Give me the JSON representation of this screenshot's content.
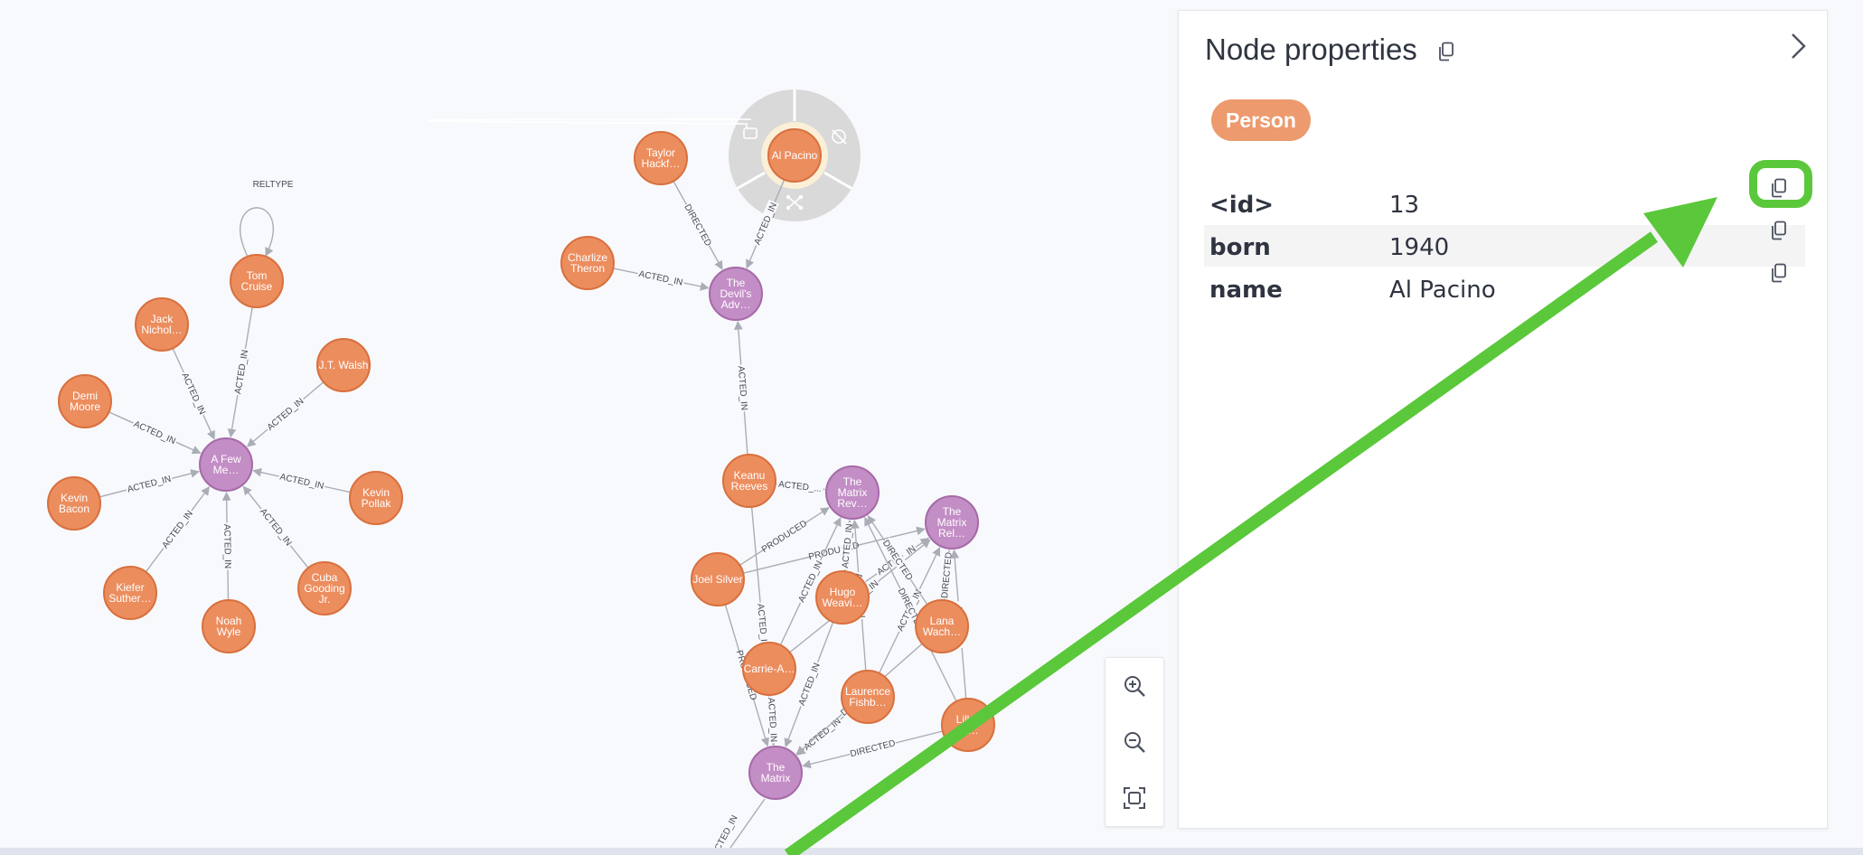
{
  "graph": {
    "colors": {
      "person_fill": "#ec8d5e",
      "person_stroke": "#d8703e",
      "movie_fill": "#c38dc5",
      "movie_stroke": "#a56aa8",
      "edge": "#a9adb5"
    },
    "nodes": [
      {
        "id": "tomcruise",
        "lines": [
          "Tom",
          "Cruise"
        ],
        "kind": "person"
      },
      {
        "id": "jacknic",
        "lines": [
          "Jack",
          "Nichol…"
        ],
        "kind": "person"
      },
      {
        "id": "jtwalsh",
        "lines": [
          "J.T. Walsh"
        ],
        "kind": "person"
      },
      {
        "id": "demimoore",
        "lines": [
          "Demi",
          "Moore"
        ],
        "kind": "person"
      },
      {
        "id": "afewmen",
        "lines": [
          "A Few",
          "Me…"
        ],
        "kind": "movie"
      },
      {
        "id": "kevinbacon",
        "lines": [
          "Kevin",
          "Bacon"
        ],
        "kind": "person"
      },
      {
        "id": "kevinpollak",
        "lines": [
          "Kevin",
          "Pollak"
        ],
        "kind": "person"
      },
      {
        "id": "kiefer",
        "lines": [
          "Kiefer",
          "Suther…"
        ],
        "kind": "person"
      },
      {
        "id": "cuba",
        "lines": [
          "Cuba",
          "Gooding",
          "Jr."
        ],
        "kind": "person"
      },
      {
        "id": "noahwyle",
        "lines": [
          "Noah",
          "Wyle"
        ],
        "kind": "person"
      },
      {
        "id": "taylor",
        "lines": [
          "Taylor",
          "Hackf…"
        ],
        "kind": "person"
      },
      {
        "id": "alpacino",
        "lines": [
          "Al Pacino"
        ],
        "kind": "person",
        "selected": true
      },
      {
        "id": "charlize",
        "lines": [
          "Charlize",
          "Theron"
        ],
        "kind": "person"
      },
      {
        "id": "devils",
        "lines": [
          "The",
          "Devil's",
          "Adv…"
        ],
        "kind": "movie"
      },
      {
        "id": "keanu",
        "lines": [
          "Keanu",
          "Reeves"
        ],
        "kind": "person"
      },
      {
        "id": "matrixrev",
        "lines": [
          "The",
          "Matrix",
          "Rev…"
        ],
        "kind": "movie"
      },
      {
        "id": "matrixrel",
        "lines": [
          "The",
          "Matrix",
          "Rel…"
        ],
        "kind": "movie"
      },
      {
        "id": "joelsilver",
        "lines": [
          "Joel Silver"
        ],
        "kind": "person"
      },
      {
        "id": "hugo",
        "lines": [
          "Hugo",
          "Weavi…"
        ],
        "kind": "person"
      },
      {
        "id": "lana",
        "lines": [
          "Lana",
          "Wach…"
        ],
        "kind": "person"
      },
      {
        "id": "carrie",
        "lines": [
          "Carrie-A…"
        ],
        "kind": "person"
      },
      {
        "id": "laurence",
        "lines": [
          "Laurence",
          "Fishb…"
        ],
        "kind": "person"
      },
      {
        "id": "lilly",
        "lines": [
          "Lill…",
          "W…"
        ],
        "kind": "person"
      },
      {
        "id": "matrix",
        "lines": [
          "The",
          "Matrix"
        ],
        "kind": "movie"
      }
    ],
    "edges": [
      {
        "from": "tomcruise",
        "to": "tomcruise",
        "label": "RELTYPE",
        "self": true
      },
      {
        "from": "tomcruise",
        "to": "afewmen",
        "label": "ACTED_IN"
      },
      {
        "from": "jacknic",
        "to": "afewmen",
        "label": "ACTED_IN"
      },
      {
        "from": "jtwalsh",
        "to": "afewmen",
        "label": "ACTED_IN"
      },
      {
        "from": "demimoore",
        "to": "afewmen",
        "label": "ACTED_IN"
      },
      {
        "from": "kevinbacon",
        "to": "afewmen",
        "label": "ACTED_IN"
      },
      {
        "from": "kevinpollak",
        "to": "afewmen",
        "label": "ACTED_IN"
      },
      {
        "from": "kiefer",
        "to": "afewmen",
        "label": "ACTED_IN"
      },
      {
        "from": "cuba",
        "to": "afewmen",
        "label": "ACTED_IN"
      },
      {
        "from": "noahwyle",
        "to": "afewmen",
        "label": "ACTED_IN"
      },
      {
        "from": "taylor",
        "to": "devils",
        "label": "DIRECTED"
      },
      {
        "from": "alpacino",
        "to": "devils",
        "label": "ACTED_IN"
      },
      {
        "from": "charlize",
        "to": "devils",
        "label": "ACTED_IN"
      },
      {
        "from": "keanu",
        "to": "devils",
        "label": "ACTED_IN"
      },
      {
        "from": "keanu",
        "to": "matrixrev",
        "label": "ACTED_..."
      },
      {
        "from": "keanu",
        "to": "matrix",
        "label": "ACTED_IN"
      },
      {
        "from": "joelsilver",
        "to": "matrixrev",
        "label": "PRODUCED"
      },
      {
        "from": "joelsilver",
        "to": "matrixrel",
        "label": "PRODUCED"
      },
      {
        "from": "joelsilver",
        "to": "matrix",
        "label": "PRODUCED"
      },
      {
        "from": "hugo",
        "to": "matrixrev",
        "label": "ACTED_IN"
      },
      {
        "from": "hugo",
        "to": "matrixrel",
        "label": "ACTED_IN"
      },
      {
        "from": "hugo",
        "to": "matrix",
        "label": "ACTED_IN"
      },
      {
        "from": "carrie",
        "to": "matrixrev",
        "label": "ACTED_IN"
      },
      {
        "from": "carrie",
        "to": "matrixrel",
        "label": "ACTED_IN"
      },
      {
        "from": "carrie",
        "to": "matrix",
        "label": "ACTED_IN"
      },
      {
        "from": "laurence",
        "to": "matrixrev",
        "label": "ACTED_IN"
      },
      {
        "from": "laurence",
        "to": "matrixrel",
        "label": "ACTED_IN"
      },
      {
        "from": "laurence",
        "to": "matrix",
        "label": "ACTED_IN"
      },
      {
        "from": "lana",
        "to": "matrixrev",
        "label": "DIRECTED"
      },
      {
        "from": "lana",
        "to": "matrixrel",
        "label": "DIRECTED"
      },
      {
        "from": "lana",
        "to": "matrix",
        "label": "DIRECTED"
      },
      {
        "from": "lilly",
        "to": "matrixrev",
        "label": "DIRECTED"
      },
      {
        "from": "lilly",
        "to": "matrixrel",
        "label": "DIREC..."
      },
      {
        "from": "lilly",
        "to": "matrix",
        "label": "DIRECTED"
      }
    ],
    "dangling_label": "CTED_IN",
    "ring_icons": [
      "lock-open-icon",
      "hide-node-icon",
      "expand-node-icon"
    ]
  },
  "zoom": {
    "icons": [
      "zoom-in-icon",
      "zoom-out-icon",
      "fit-to-screen-icon"
    ]
  },
  "panel": {
    "title": "Node properties",
    "label": "Person",
    "props": [
      {
        "key": "<id>",
        "value": "13"
      },
      {
        "key": "born",
        "value": "1940"
      },
      {
        "key": "name",
        "value": "Al Pacino"
      }
    ]
  },
  "annotation": {
    "arrow_color": "#5ac83a"
  }
}
